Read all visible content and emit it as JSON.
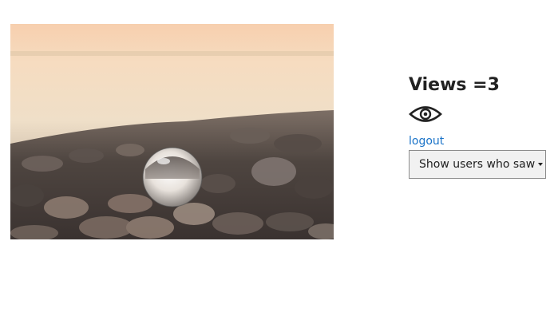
{
  "stats": {
    "views_label": "Views =",
    "views_count": "3"
  },
  "icons": {
    "eye": "eye-icon"
  },
  "links": {
    "logout": "logout"
  },
  "dropdown": {
    "label": "Show users who saw"
  },
  "colors": {
    "link": "#1a73c8",
    "button_bg": "#f1f1f1",
    "button_border": "#8c8c8c"
  }
}
